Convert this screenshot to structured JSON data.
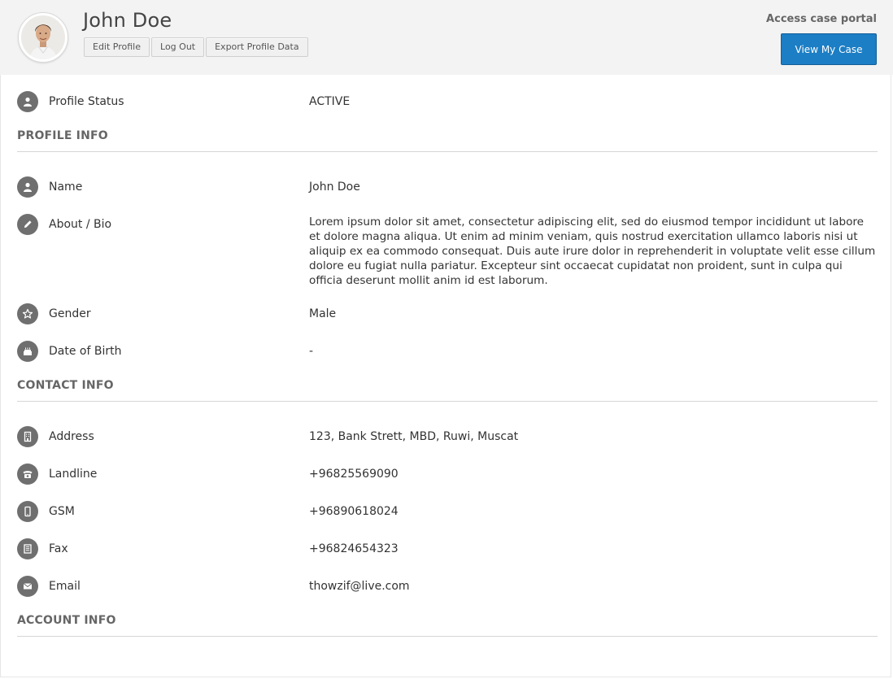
{
  "header": {
    "user_name": "John Doe",
    "buttons": {
      "edit_profile": "Edit Profile",
      "log_out": "Log Out",
      "export_profile_data": "Export Profile Data"
    },
    "portal_label": "Access case portal",
    "view_case_button": "View My Case"
  },
  "status": {
    "label": "Profile Status",
    "value": "ACTIVE",
    "icon": "user-icon"
  },
  "sections": {
    "profile_info": "PROFILE INFO",
    "contact_info": "CONTACT INFO",
    "account_info": "ACCOUNT INFO"
  },
  "profile": {
    "name": {
      "label": "Name",
      "value": "John Doe",
      "icon": "user-icon"
    },
    "bio": {
      "label": "About / Bio",
      "value": "Lorem ipsum dolor sit amet, consectetur adipiscing elit, sed do eiusmod tempor incididunt ut labore et dolore magna aliqua. Ut enim ad minim veniam, quis nostrud exercitation ullamco laboris nisi ut aliquip ex ea commodo consequat. Duis aute irure dolor in reprehenderit in voluptate velit esse cillum dolore eu fugiat nulla pariatur. Excepteur sint occaecat cupidatat non proident, sunt in culpa qui officia deserunt mollit anim id est laborum.",
      "icon": "pencil-icon"
    },
    "gender": {
      "label": "Gender",
      "value": "Male",
      "icon": "star-icon"
    },
    "dob": {
      "label": "Date of Birth",
      "value": "-",
      "icon": "cake-icon"
    }
  },
  "contact": {
    "address": {
      "label": "Address",
      "value": "123, Bank Strett, MBD, Ruwi, Muscat",
      "icon": "building-icon"
    },
    "landline": {
      "label": "Landline",
      "value": "+96825569090",
      "icon": "phone-icon"
    },
    "gsm": {
      "label": "GSM",
      "value": "+96890618024",
      "icon": "mobile-icon"
    },
    "fax": {
      "label": "Fax",
      "value": "+96824654323",
      "icon": "fax-icon"
    },
    "email": {
      "label": "Email",
      "value": "thowzif@live.com",
      "icon": "envelope-icon"
    }
  },
  "colors": {
    "header_bg": "#f3f3f3",
    "primary": "#1c7ec5",
    "icon_bg": "#6f6f6f"
  }
}
